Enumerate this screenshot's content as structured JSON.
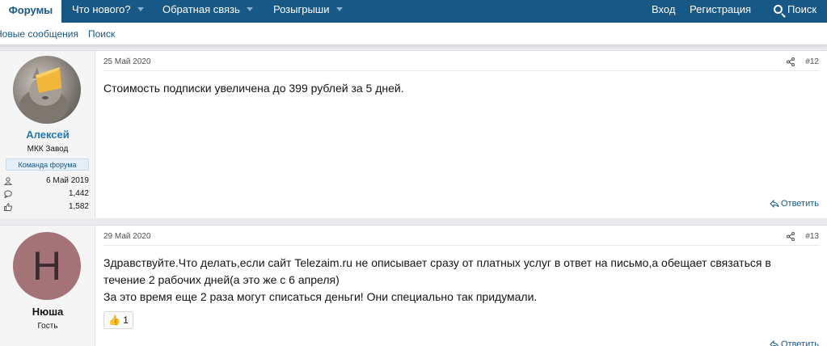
{
  "nav": {
    "active_tab": "Форумы",
    "items": [
      "Что нового?",
      "Обратная связь",
      "Розыгрыши"
    ],
    "login": "Вход",
    "register": "Регистрация",
    "search": "Поиск"
  },
  "subnav": {
    "new_messages": "Новые сообщения",
    "search": "Поиск"
  },
  "posts": [
    {
      "date": "25 Май 2020",
      "number": "#12",
      "author": "Алексей",
      "author_title": "МКК Завод",
      "badge": "Команда форума",
      "joined": "6 Май 2019",
      "messages": "1,442",
      "reactions": "1,582",
      "text": [
        "Стоимость подписки увеличена до 399 рублей за 5 дней."
      ],
      "reply": "Ответить"
    },
    {
      "date": "29 Май 2020",
      "number": "#13",
      "author": "Нюша",
      "author_initial": "Н",
      "author_title": "Гость",
      "text": [
        "Здравствуйте.Что делать,если сайт Telezaim.ru не описывает сразу от платных услуг в ответ на письмо,а обещает связаться в",
        "течение 2 рабочих дней(а это же с 6 апреля)",
        "За это время еще 2 раза могут списаться деньги! Они специально так придумали."
      ],
      "reaction_emoji": "👍",
      "reaction_count": "1",
      "reply": "Ответить"
    }
  ],
  "colors": {
    "nav_bg": "#185886",
    "link": "#185886",
    "author": "#2577b1",
    "avatar_letter_bg": "#a37378"
  }
}
